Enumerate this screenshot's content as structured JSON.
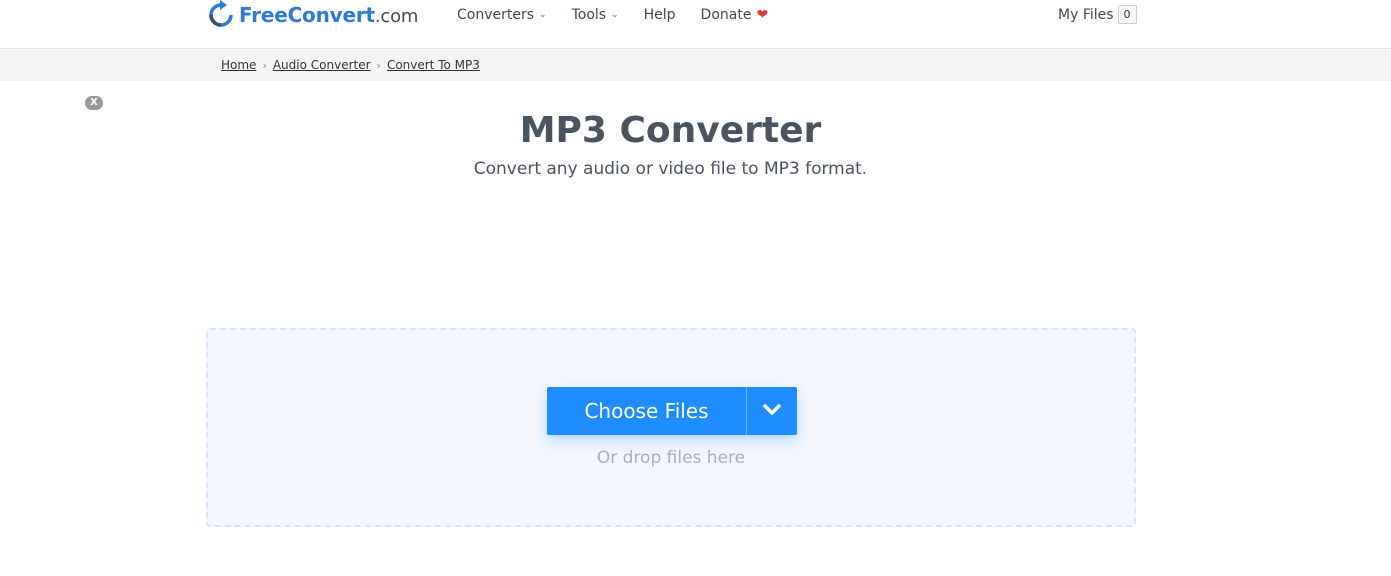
{
  "header": {
    "logo_main": "FreeConvert",
    "logo_domain": ".com",
    "nav": [
      {
        "label": "Converters",
        "icon": "chevron-down-icon"
      },
      {
        "label": "Tools",
        "icon": "chevron-down-icon"
      },
      {
        "label": "Help"
      },
      {
        "label": "Donate",
        "icon": "heart-icon"
      }
    ],
    "my_files_label": "My Files",
    "my_files_count": "0"
  },
  "breadcrumb": {
    "items": [
      "Home",
      "Audio Converter",
      "Convert To MP3"
    ]
  },
  "ad_close_label": "X",
  "main": {
    "title": "MP3 Converter",
    "subtitle": "Convert any audio or video file to MP3 format.",
    "choose_files_label": "Choose Files",
    "drop_hint": "Or drop files here"
  },
  "colors": {
    "brand_blue": "#1e8bff",
    "logo_blue": "#2d7ad6",
    "heart_red": "#e53935",
    "dropzone_bg": "#f3f7fd"
  }
}
